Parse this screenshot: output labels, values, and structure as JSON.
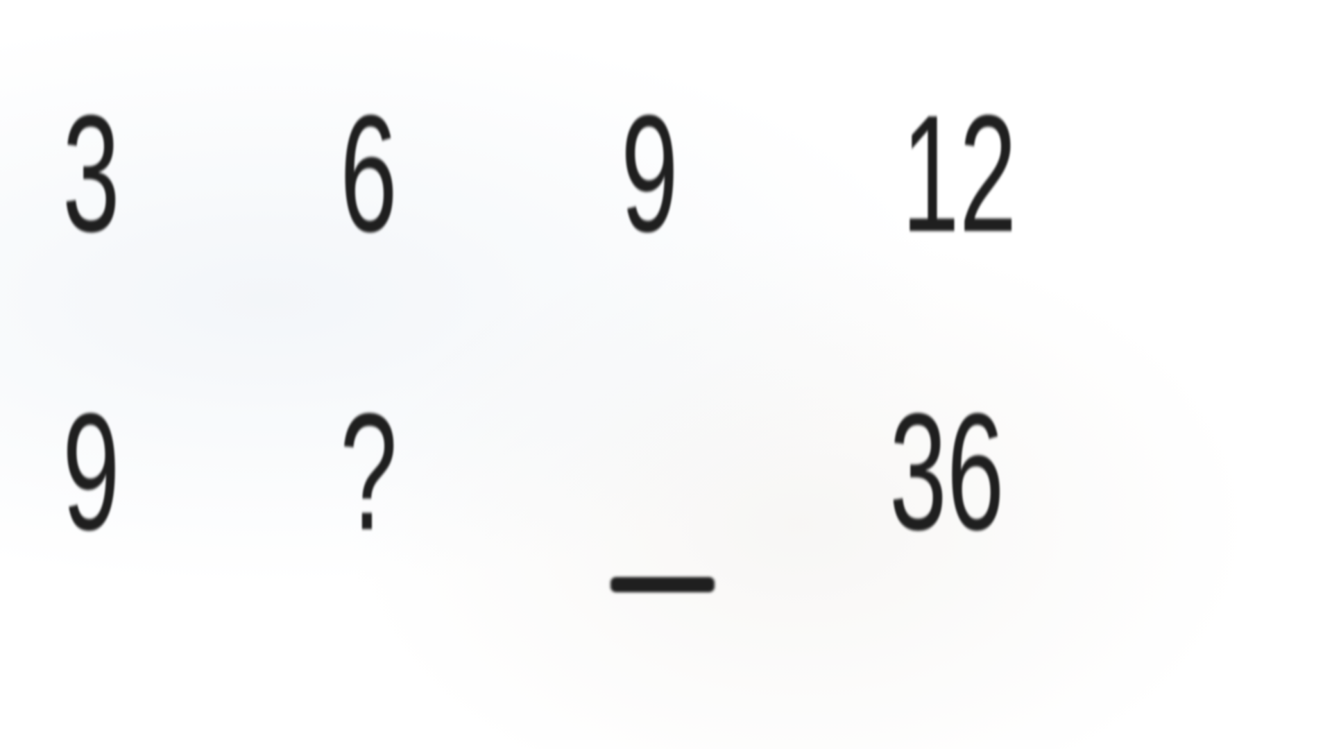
{
  "puzzle": {
    "row1": [
      "3",
      "6",
      "9",
      "12"
    ],
    "row2": [
      "9",
      "?",
      "",
      "36"
    ],
    "blank_marker": "_"
  }
}
